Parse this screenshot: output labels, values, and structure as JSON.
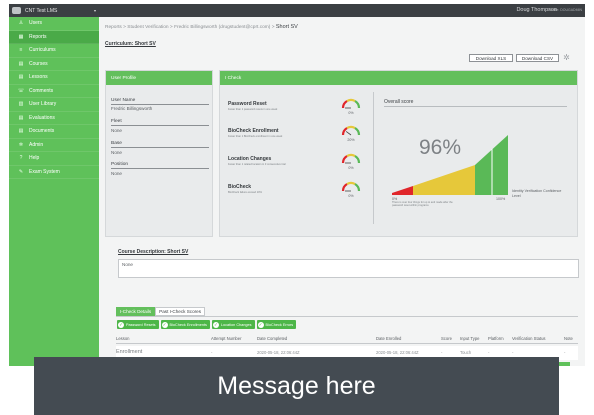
{
  "app": {
    "title": "CNT Test LMS",
    "caret": "▾",
    "user_name": "Doug Thompson",
    "user_sub": "Profile: DOUGADMIN"
  },
  "sidebar": {
    "items": [
      {
        "icon": "person",
        "label": "Users",
        "glyph": "♙"
      },
      {
        "icon": "grid",
        "label": "Reports",
        "glyph": "▦"
      },
      {
        "icon": "lines",
        "label": "Curriculums",
        "glyph": "≡"
      },
      {
        "icon": "doc",
        "label": "Courses",
        "glyph": "▤"
      },
      {
        "icon": "doc",
        "label": "Lessons",
        "glyph": "▤"
      },
      {
        "icon": "chat",
        "label": "Comments",
        "glyph": "☏"
      },
      {
        "icon": "book",
        "label": "User Library",
        "glyph": "▥"
      },
      {
        "icon": "doc",
        "label": "Evaluations",
        "glyph": "▤"
      },
      {
        "icon": "doc",
        "label": "Documents",
        "glyph": "▤"
      },
      {
        "icon": "gear",
        "label": "Admin",
        "glyph": "✲"
      },
      {
        "icon": "help",
        "label": "Help",
        "glyph": "?"
      },
      {
        "icon": "exam",
        "label": "Exam System",
        "glyph": "✎"
      }
    ],
    "active_index": 1
  },
  "breadcrumb": {
    "trail": "Reports  >  Student Verification  >  Fredric Billingsworth (drugstudent@cprt.com)  >  ",
    "current": "Short SV"
  },
  "curriculum_label": "Curriculum: Short SV",
  "buttons": {
    "download_xls": "Download XLS",
    "download_csv": "Download CSV"
  },
  "profile": {
    "heading": "User Profile",
    "fields": [
      {
        "label": "User Name",
        "value": "Fredric Billingsworth"
      },
      {
        "label": "Fleet",
        "value": "None"
      },
      {
        "label": "Base",
        "value": "None"
      },
      {
        "label": "Position",
        "value": "None"
      }
    ]
  },
  "icheck": {
    "heading": "I Check",
    "rows": [
      {
        "title": "Password Reset",
        "sub": "Fewer than 1 password resets in one week",
        "pct": "0%",
        "level": 0.0
      },
      {
        "title": "BioCheck Enrollment",
        "sub": "Fewer than 1 BioCheck enrollment in one week",
        "pct": "20%",
        "level": 0.2
      },
      {
        "title": "Location Changes",
        "sub": "Fewer than 1 related location in 3 consecutive trial",
        "pct": "0%",
        "level": 0.0
      },
      {
        "title": "BioCheck",
        "sub": "BioCheck failure exceed 10%",
        "pct": "0%",
        "level": 0.0
      }
    ],
    "overall_label": "Overall score",
    "overall_pct": "96%",
    "overall_level": 0.96,
    "scale_min": "0%",
    "scale_max": "100%",
    "legend_title": "Identity Verification Confidence Level",
    "note": "There is over four things for up to and made after the password reset within programs",
    "colors": {
      "red": "#e0262b",
      "yellow": "#e6c83a",
      "green": "#5ab957"
    }
  },
  "course": {
    "label": "Course Description: Short SV",
    "value": "None"
  },
  "tabs": [
    {
      "label": "I-Check Details",
      "active": true
    },
    {
      "label": "Past I-Check Scores",
      "active": false
    }
  ],
  "chips": [
    "Password Resets",
    "BioCheck Enrollments",
    "Location Changes",
    "BioCheck Errors"
  ],
  "table": {
    "headers": [
      "Lesson",
      "Attempt Number",
      "Date Completed",
      "Date Enrolled",
      "Score",
      "Input Type",
      "Platform",
      "Verification Status",
      "Note"
    ],
    "rows": [
      [
        "Enrollment",
        "-",
        "2020-05-18, 22:06:44Z",
        "2020-05-18, 22:06:44Z",
        "-",
        "Touch",
        "-",
        "-",
        "-"
      ]
    ]
  },
  "message": "Message here"
}
